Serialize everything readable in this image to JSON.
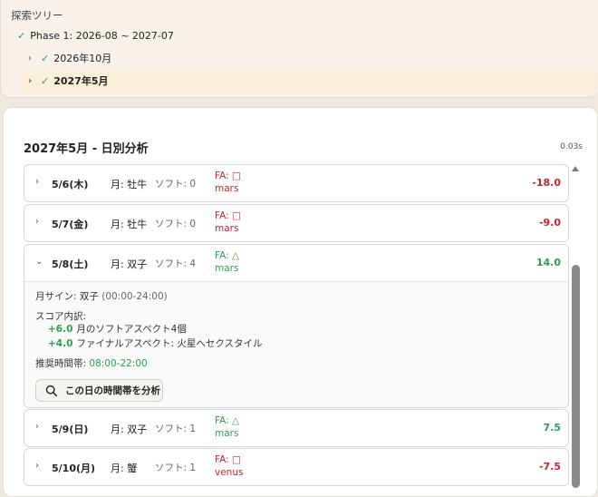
{
  "tree": {
    "title": "探索ツリー",
    "items": [
      {
        "label": "Phase 1: 2026-08 ~ 2027-07",
        "checked": true
      },
      {
        "label": "2026年10月",
        "checked": true
      },
      {
        "label": "2027年5月",
        "checked": true,
        "selected": true
      }
    ]
  },
  "panel": {
    "heading": "2027年5月 - 日別分析",
    "timer": "0.03s"
  },
  "days": [
    {
      "date": "5/6(木)",
      "moon": "月: 牡牛",
      "soft": "ソフト: 0",
      "fa": "FA: □",
      "planet": "mars",
      "score": "-18.0",
      "tone": "negative"
    },
    {
      "date": "5/7(金)",
      "moon": "月: 牡牛",
      "soft": "ソフト: 0",
      "fa": "FA: □",
      "planet": "mars",
      "score": "-9.0",
      "tone": "negative"
    },
    {
      "date": "5/8(土)",
      "moon": "月: 双子",
      "soft": "ソフト: 4",
      "fa": "FA: △",
      "planet": "mars",
      "score": "14.0",
      "tone": "positive",
      "expanded": true
    },
    {
      "date": "5/9(日)",
      "moon": "月: 双子",
      "soft": "ソフト: 1",
      "fa": "FA: △",
      "planet": "mars",
      "score": "7.5",
      "tone": "positive"
    },
    {
      "date": "5/10(月)",
      "moon": "月: 蟹",
      "soft": "ソフト: 1",
      "fa": "FA: □",
      "planet": "venus",
      "score": "-7.5",
      "tone": "negative"
    }
  ],
  "detail": {
    "moon_sign_label": "月サイン: 双子",
    "moon_sign_time": "(00:00-24:00)",
    "score_title": "スコア内訳:",
    "breakdown": [
      {
        "value": "+6.0",
        "text": "月のソフトアスペクト4個"
      },
      {
        "value": "+4.0",
        "text": "ファイナルアスペクト: 火星へセクスタイル"
      }
    ],
    "recommend_label": "推奨時間帯:",
    "recommend_value": "08:00-22:00",
    "analyze_button": "この日の時間帯を分析"
  },
  "colors": {
    "positive": "#2e9e55",
    "negative": "#c0262d",
    "selected_row": "#fbefd9"
  },
  "icons": [
    "check-icon",
    "chevron-right-icon",
    "chevron-down-icon",
    "search-icon"
  ]
}
